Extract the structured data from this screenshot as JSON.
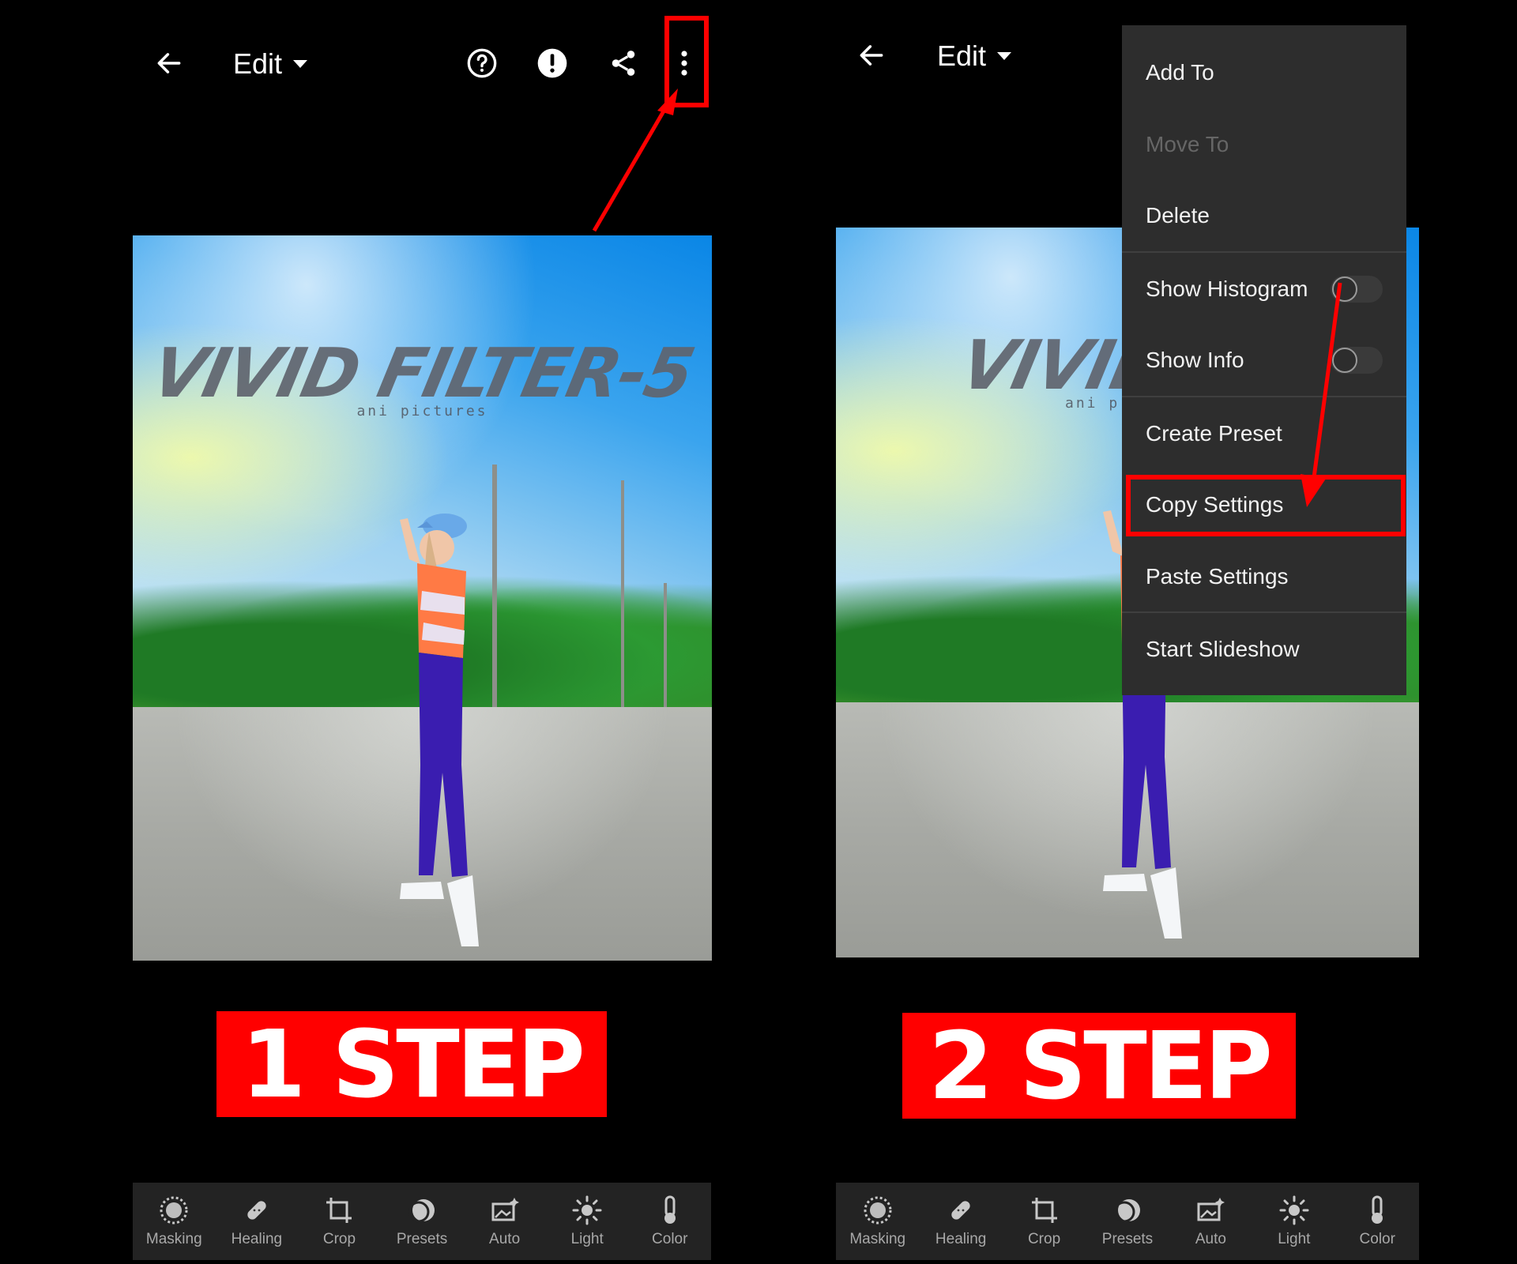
{
  "colors": {
    "accent_red": "#ff0000",
    "toolbar_bg": "#232323",
    "menu_bg": "#2d2d2d"
  },
  "step1": {
    "top_bar": {
      "edit_label": "Edit",
      "icons": [
        "back-arrow-icon",
        "help-icon",
        "alert-icon",
        "share-icon",
        "more-vertical-icon"
      ]
    },
    "photo": {
      "watermark_title": "VIVID FILTER-5",
      "watermark_subtitle": "ani pictures"
    },
    "step_label": "1 STEP"
  },
  "step2": {
    "top_bar": {
      "edit_label": "Edit"
    },
    "photo": {
      "watermark_title": "VIVID F",
      "watermark_subtitle": "ani p"
    },
    "menu": {
      "items": [
        {
          "label": "Add To",
          "enabled": true
        },
        {
          "label": "Move To",
          "enabled": false
        },
        {
          "label": "Delete",
          "enabled": true
        },
        {
          "label": "Show Histogram",
          "enabled": true,
          "toggle": false
        },
        {
          "label": "Show Info",
          "enabled": true,
          "toggle": false
        },
        {
          "label": "Create Preset",
          "enabled": true
        },
        {
          "label": "Copy Settings",
          "enabled": true,
          "highlighted": true
        },
        {
          "label": "Paste Settings",
          "enabled": true
        },
        {
          "label": "Start Slideshow",
          "enabled": true
        }
      ]
    },
    "step_label": "2 STEP"
  },
  "toolbar": {
    "tools": [
      {
        "label": "Masking",
        "icon": "masking-icon"
      },
      {
        "label": "Healing",
        "icon": "healing-icon"
      },
      {
        "label": "Crop",
        "icon": "crop-icon"
      },
      {
        "label": "Presets",
        "icon": "presets-icon"
      },
      {
        "label": "Auto",
        "icon": "auto-icon"
      },
      {
        "label": "Light",
        "icon": "light-icon"
      },
      {
        "label": "Color",
        "icon": "color-icon"
      }
    ]
  }
}
